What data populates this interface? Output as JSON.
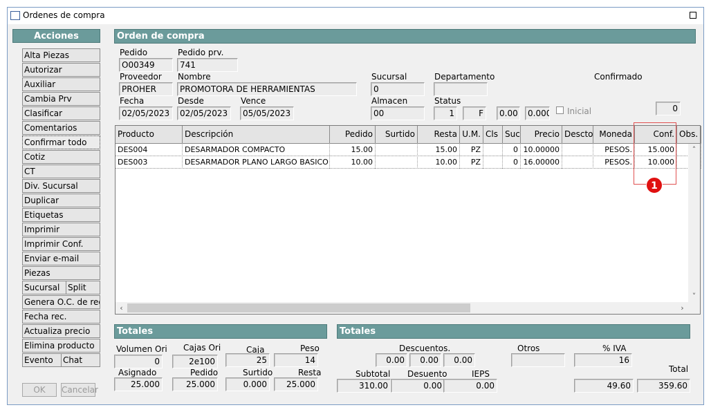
{
  "window": {
    "title": "Ordenes de compra"
  },
  "actions": {
    "header": "Acciones",
    "items": [
      "Alta Piezas",
      "Autorizar",
      "Auxiliar",
      "Cambia Prv",
      "Clasificar",
      "Comentarios",
      "Confirmar todo",
      "Cotiz",
      "CT",
      "Div. Sucursal",
      "Duplicar",
      "Etiquetas",
      "Imprimir",
      "Imprimir Conf.",
      "Enviar e-mail",
      "Piezas"
    ],
    "sucursal": "Sucursal",
    "split": "Split",
    "genera": "Genera O.C. de req.",
    "fecha_rec": "Fecha rec.",
    "actualiza": "Actualiza precio",
    "elimina": "Elimina producto",
    "evento": "Evento",
    "chat": "Chat",
    "ok": "OK",
    "cancelar": "Cancelar"
  },
  "order": {
    "header": "Orden de compra",
    "pedido_label": "Pedido",
    "pedido": "O00349",
    "pedido_prv_label": "Pedido prv.",
    "pedido_prv": "741",
    "proveedor_label": "Proveedor",
    "proveedor": "PROHER",
    "nombre_label": "Nombre",
    "nombre": "PROMOTORA DE HERRAMIENTAS",
    "sucursal_label": "Sucursal",
    "sucursal": "0",
    "departamento_label": "Departamento",
    "departamento": "",
    "confirmado_label": "Confirmado",
    "fecha_label": "Fecha",
    "fecha": "02/05/2023",
    "desde_label": "Desde",
    "desde": "02/05/2023",
    "vence_label": "Vence",
    "vence": "05/05/2023",
    "almacen_label": "Almacen",
    "almacen": "00",
    "status_label": "Status",
    "status_num": "1",
    "status_code": "F",
    "val1": "0.00",
    "val2": "0.000",
    "inicial_label": "Inicial",
    "confirmado_value": "0"
  },
  "grid": {
    "columns": [
      "Producto",
      "Descripción",
      "Pedido",
      "Surtido",
      "Resta",
      "U.M.",
      "Cls",
      "Suc",
      "Precio",
      "Descto",
      "Moneda",
      "Conf.",
      "Obs."
    ],
    "rows": [
      [
        "DES004",
        "DESARMADOR COMPACTO",
        "15.00",
        "",
        "15.00",
        "PZ",
        "",
        "0",
        "10.00000",
        "",
        "PESOS.",
        "15.000",
        ""
      ],
      [
        "DES003",
        "DESARMADOR PLANO LARGO BASICO",
        "10.00",
        "",
        "10.00",
        "PZ",
        "",
        "0",
        "16.00000",
        "",
        "PESOS.",
        "10.000",
        ""
      ]
    ]
  },
  "annotation": {
    "badge": "1"
  },
  "totales_left": {
    "header": "Totales",
    "volumen_label": "Volumen Ori",
    "volumen": "0",
    "cajas_label": "Cajas Ori",
    "cajas": "2e100",
    "caja_label": "Caja",
    "caja": "25",
    "peso_label": "Peso",
    "peso": "14",
    "asignado_label": "Asignado",
    "asignado": "25.000",
    "pedido_label": "Pedido",
    "pedido": "25.000",
    "surtido_label": "Surtido",
    "surtido": "0.000",
    "resta_label": "Resta",
    "resta": "25.000"
  },
  "totales_right": {
    "header": "Totales",
    "descuentos_label": "Descuentos.",
    "desc1": "0.00",
    "desc2": "0.00",
    "desc3": "0.00",
    "otros_label": "Otros",
    "otros": "",
    "iva_label": "% IVA",
    "iva": "16",
    "total_label": "Total",
    "subtotal_label": "Subtotal",
    "subtotal": "310.00",
    "desuento_label": "Desuento",
    "desuento": "0.00",
    "ieps_label": "IEPS",
    "ieps": "0.00",
    "iva_amount": "49.60",
    "total": "359.60"
  }
}
